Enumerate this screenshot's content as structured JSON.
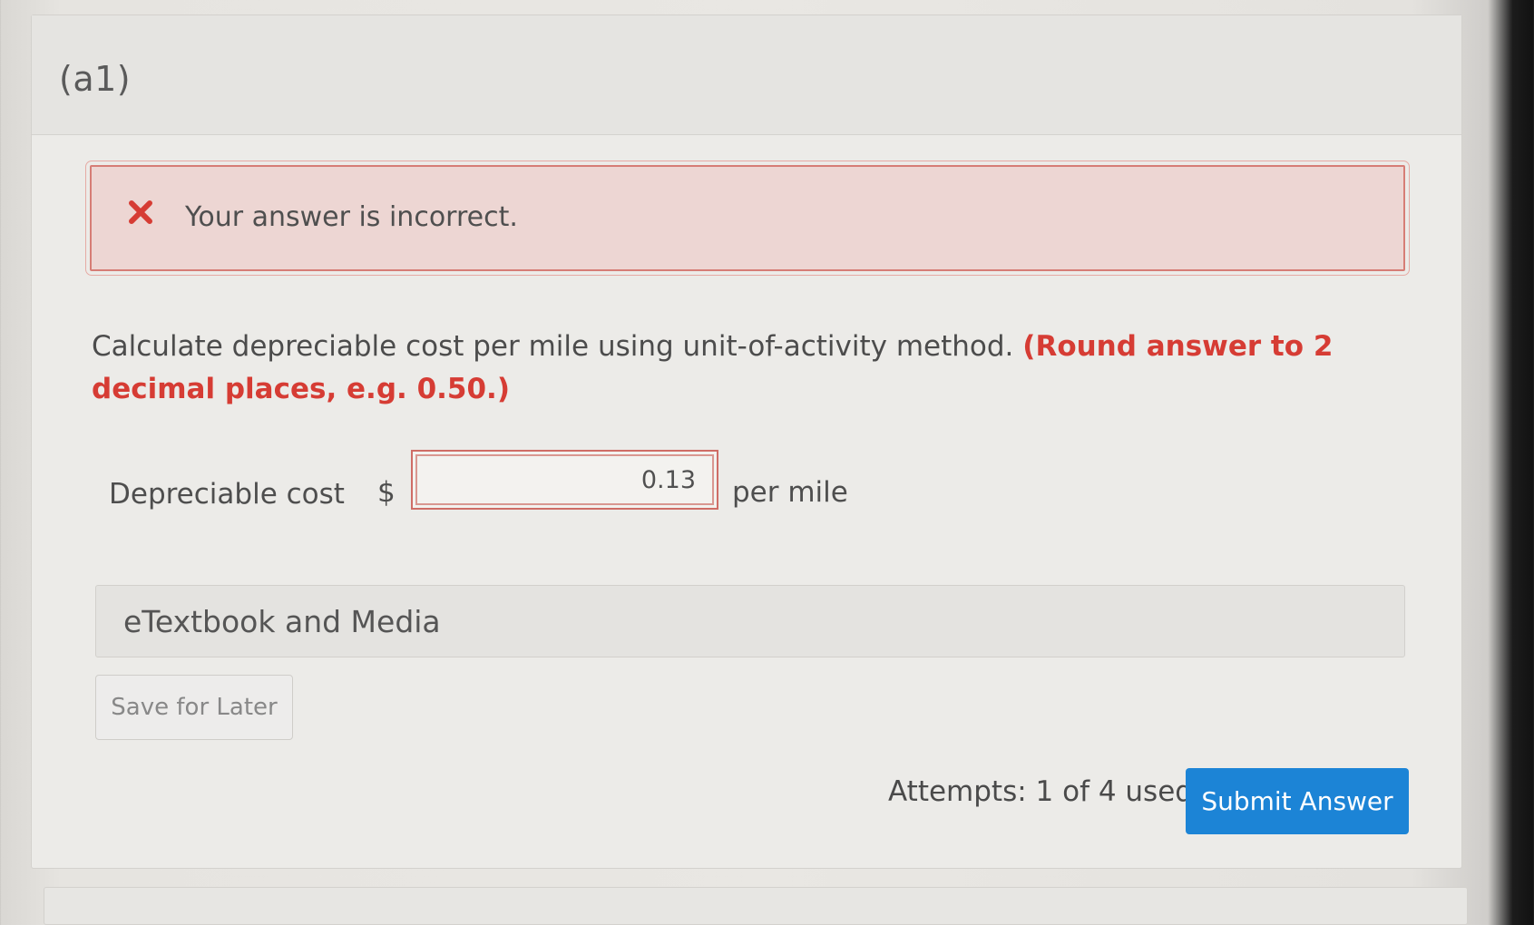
{
  "part": {
    "label": "(a1)"
  },
  "feedback": {
    "icon": "close-icon",
    "message": "Your answer is incorrect.",
    "color": "#d63c34"
  },
  "question": {
    "text": "Calculate depreciable cost per mile using unit-of-activity method.",
    "hint": "(Round answer to 2 decimal places, e.g. 0.50.)"
  },
  "answer_row": {
    "label": "Depreciable cost",
    "currency": "$",
    "value": "0.13",
    "unit": "per mile"
  },
  "etextbook": {
    "label": "eTextbook and Media"
  },
  "actions": {
    "save_label": "Save for Later",
    "attempts": "Attempts: 1 of 4 used",
    "submit_label": "Submit Answer",
    "submit_color": "#1c84d6"
  }
}
